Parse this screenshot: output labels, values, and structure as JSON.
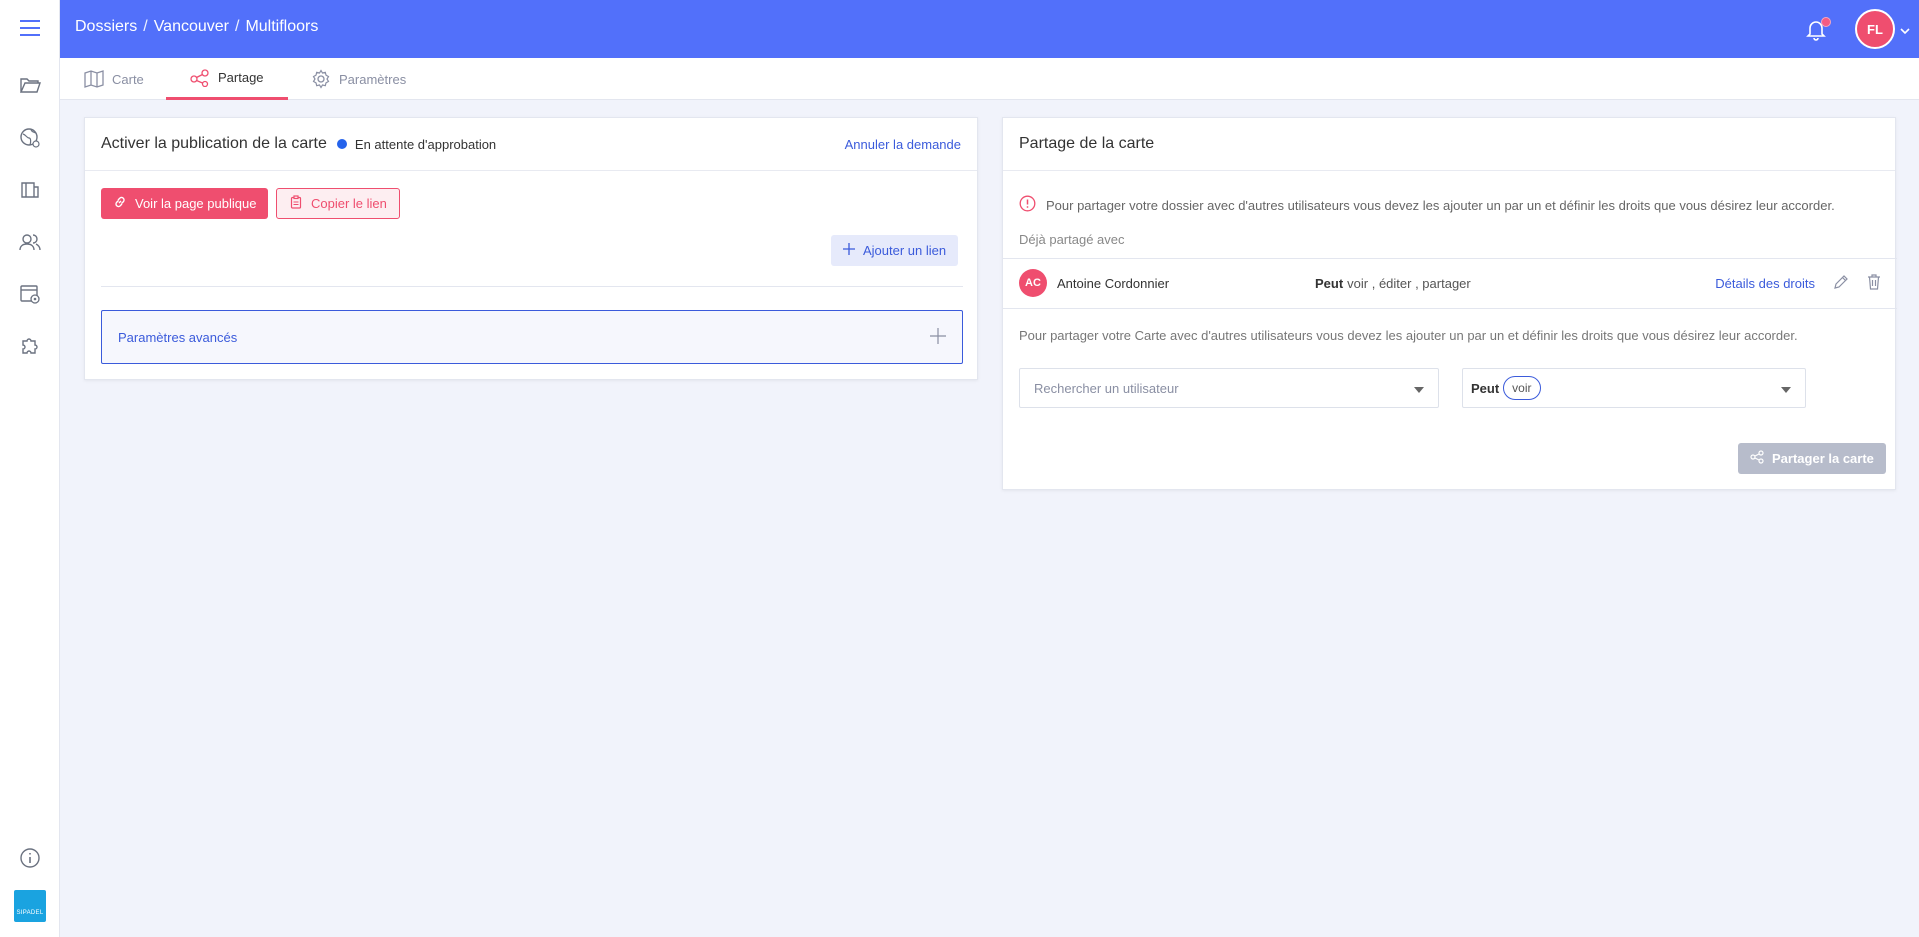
{
  "breadcrumb": [
    "Dossiers",
    "Vancouver",
    "Multifloors"
  ],
  "breadcrumb_separator": "/",
  "user": {
    "initials": "FL"
  },
  "tabs": [
    {
      "label": "Carte",
      "icon": "map-icon"
    },
    {
      "label": "Partage",
      "icon": "share-icon",
      "active": true
    },
    {
      "label": "Paramètres",
      "icon": "gear-icon"
    }
  ],
  "publication": {
    "title": "Activer la publication de la carte",
    "status": "En attente d'approbation",
    "cancel_label": "Annuler la demande",
    "view_public_label": "Voir la page publique",
    "copy_link_label": "Copier le lien",
    "add_link_label": "Ajouter un lien",
    "advanced_label": "Paramètres avancés"
  },
  "sharing": {
    "title": "Partage de la carte",
    "warning": "Pour partager votre dossier avec d'autres utilisateurs vous devez les ajouter un par un et définir les droits que vous désirez leur accorder.",
    "already_shared_label": "Déjà partagé avec",
    "users": [
      {
        "initials": "AC",
        "name": "Antoine Cordonnier",
        "rights_prefix": "Peut",
        "rights": "voir , éditer , partager",
        "details_label": "Détails des droits"
      }
    ],
    "instructions": "Pour partager votre Carte avec d'autres utilisateurs vous devez les ajouter un par un et définir les droits que vous désirez leur accorder.",
    "search_placeholder": "Rechercher un utilisateur",
    "permission_prefix": "Peut",
    "permission_chip": "voir",
    "share_button_label": "Partager la carte"
  },
  "logo_text": "SIPADEL",
  "colors": {
    "topbar": "#5270fa",
    "accent": "#ef4e6f",
    "link": "#3b5bdb",
    "status_dot": "#2563eb"
  }
}
